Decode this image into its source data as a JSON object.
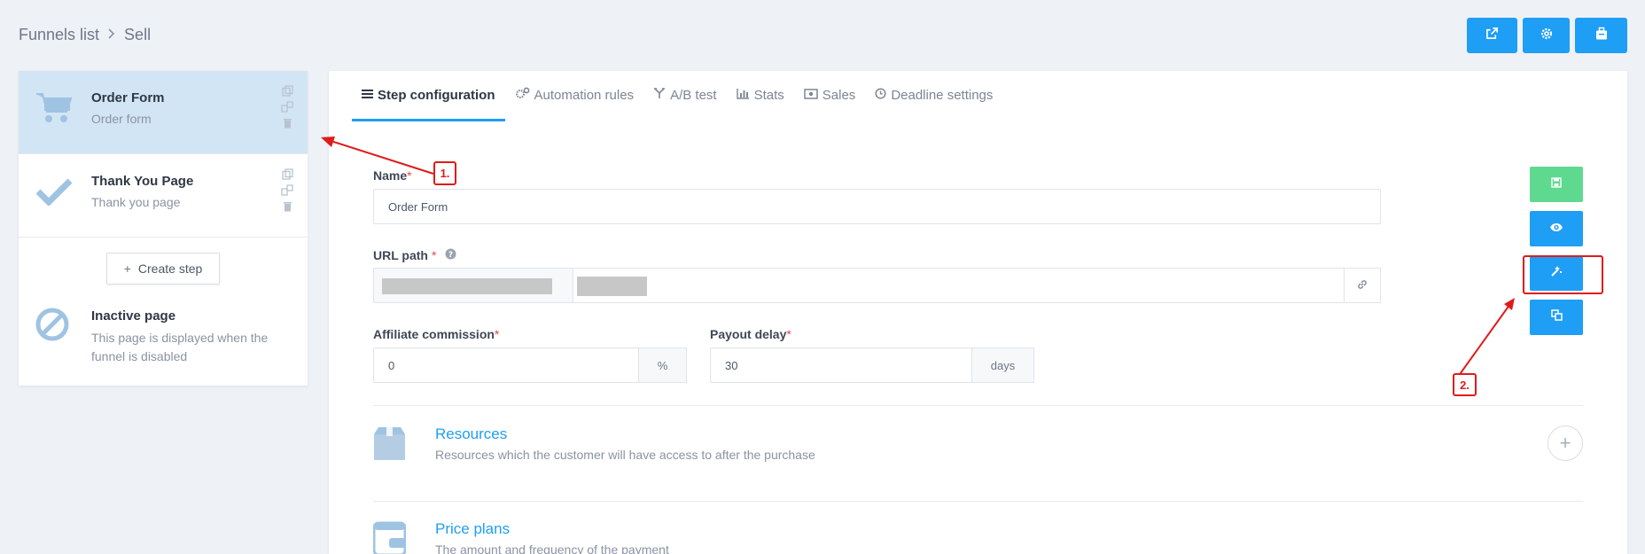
{
  "breadcrumb": {
    "root": "Funnels list",
    "current": "Sell"
  },
  "top_actions": [
    {
      "icon": "external-link-icon"
    },
    {
      "icon": "gear-icon"
    },
    {
      "icon": "briefcase-icon"
    }
  ],
  "sidebar": {
    "steps": [
      {
        "title": "Order Form",
        "subtitle": "Order form",
        "icon": "cart-icon",
        "active": true
      },
      {
        "title": "Thank You Page",
        "subtitle": "Thank you page",
        "icon": "check-icon",
        "active": false
      }
    ],
    "create_step_label": "Create step",
    "inactive": {
      "title": "Inactive page",
      "subtitle": "This page is displayed when the funnel is disabled"
    }
  },
  "tabs": [
    {
      "label": "Step configuration",
      "icon": "list-icon",
      "active": true
    },
    {
      "label": "Automation rules",
      "icon": "cogs-icon"
    },
    {
      "label": "A/B test",
      "icon": "split-icon"
    },
    {
      "label": "Stats",
      "icon": "bar-chart-icon"
    },
    {
      "label": "Sales",
      "icon": "money-icon"
    },
    {
      "label": "Deadline settings",
      "icon": "clock-icon"
    }
  ],
  "form": {
    "name_label": "Name",
    "name_value": "Order Form",
    "url_label": "URL path",
    "affiliate_label": "Affiliate commission",
    "affiliate_value": "0",
    "affiliate_unit": "%",
    "payout_label": "Payout delay",
    "payout_value": "30",
    "payout_unit": "days",
    "required_mark": "*"
  },
  "sections": [
    {
      "title": "Resources",
      "subtitle": "Resources which the customer will have access to after the purchase",
      "icon": "box-icon"
    },
    {
      "title": "Price plans",
      "subtitle": "The amount and frequency of the payment",
      "icon": "wallet-icon"
    }
  ],
  "side_actions": [
    {
      "icon": "save-icon",
      "color": "#5fd98f"
    },
    {
      "icon": "eye-icon",
      "color": "#1e9ef4"
    },
    {
      "icon": "magic-wand-icon",
      "color": "#1e9ef4"
    },
    {
      "icon": "copy-icon",
      "color": "#1e9ef4"
    }
  ],
  "annotations": {
    "one": "1.",
    "two": "2."
  },
  "colors": {
    "primary": "#1e9ef4",
    "success": "#5fd98f",
    "annotation": "#e01b1b",
    "active_step": "#d2e5f4"
  }
}
